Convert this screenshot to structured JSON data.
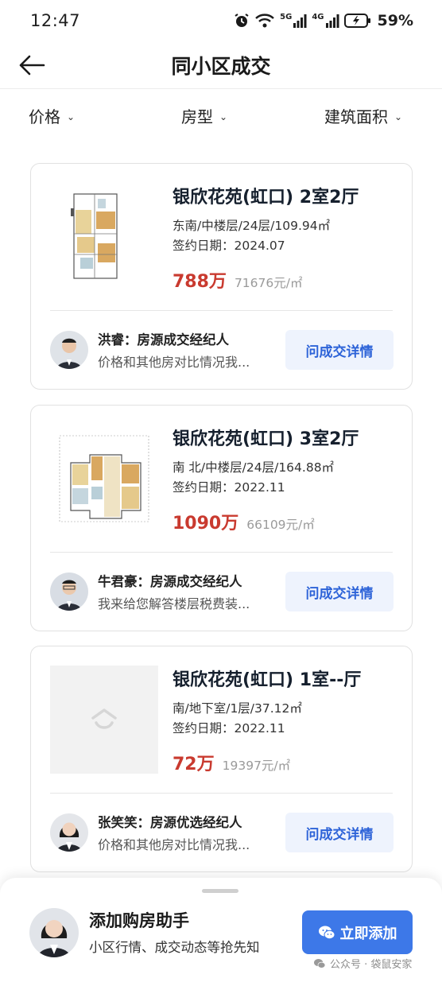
{
  "status_bar": {
    "time": "12:47",
    "network_5g": "5G",
    "network_4g": "4G",
    "battery": "59%"
  },
  "header": {
    "title": "同小区成交"
  },
  "filters": [
    {
      "label": "价格"
    },
    {
      "label": "房型"
    },
    {
      "label": "建筑面积"
    }
  ],
  "listings": [
    {
      "title": "银欣花苑(虹口) 2室2厅",
      "meta": "东南/中楼层/24层/109.94㎡",
      "date": "签约日期：2024.07",
      "price": "788万",
      "unit_price": "71676元/㎡",
      "has_floorplan": true,
      "agent": {
        "name": "洪睿：房源成交经纪人",
        "message": "价格和其他房对比情况我..."
      },
      "button": "问成交详情"
    },
    {
      "title": "银欣花苑(虹口) 3室2厅",
      "meta": "南 北/中楼层/24层/164.88㎡",
      "date": "签约日期：2022.11",
      "price": "1090万",
      "unit_price": "66109元/㎡",
      "has_floorplan": true,
      "agent": {
        "name": "牛君豪：房源成交经纪人",
        "message": "我来给您解答楼层税费装..."
      },
      "button": "问成交详情"
    },
    {
      "title": "银欣花苑(虹口) 1室--厅",
      "meta": "南/地下室/1层/37.12㎡",
      "date": "签约日期：2022.11",
      "price": "72万",
      "unit_price": "19397元/㎡",
      "has_floorplan": false,
      "agent": {
        "name": "张笑笑：房源优选经纪人",
        "message": "价格和其他房对比情况我..."
      },
      "button": "问成交详情"
    }
  ],
  "bottom_sheet": {
    "title": "添加购房助手",
    "subtitle": "小区行情、成交动态等抢先知",
    "button": "立即添加",
    "watermark": "公众号 · 袋鼠安家"
  },
  "colors": {
    "price_red": "#c93a2f",
    "accent_blue": "#3d78e8",
    "button_text_blue": "#2d63d8",
    "button_bg_light": "#eef3fd"
  }
}
